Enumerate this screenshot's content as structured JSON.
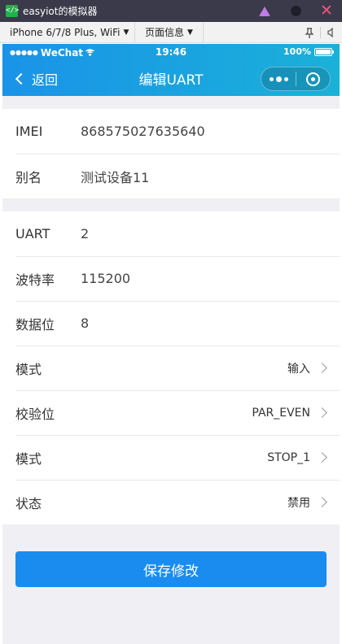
{
  "window": {
    "app_icon": "</>",
    "title": "easyiot的模拟器"
  },
  "toolbar": {
    "device": "iPhone 6/7/8 Plus, WiFi",
    "page_info": "页面信息",
    "pin_icon": "pin-icon",
    "mute_icon": "speaker-icon"
  },
  "statusbar": {
    "signal": "●●●●●",
    "carrier": "WeChat",
    "wifi": "wifi-icon",
    "time": "19:46",
    "battery": "100%"
  },
  "navbar": {
    "back_label": "返回",
    "title": "编辑UART"
  },
  "device_section": [
    {
      "label": "IMEI",
      "value": "868575027635640"
    },
    {
      "label": "别名",
      "value": "测试设备11"
    }
  ],
  "uart_section": {
    "static_rows": [
      {
        "label": "UART",
        "value": "2"
      },
      {
        "label": "波特率",
        "value": "115200"
      },
      {
        "label": "数据位",
        "value": "8"
      }
    ],
    "picker_rows": [
      {
        "label": "模式",
        "value": "输入"
      },
      {
        "label": "校验位",
        "value": "PAR_EVEN"
      },
      {
        "label": "模式",
        "value": "STOP_1"
      },
      {
        "label": "状态",
        "value": "禁用"
      }
    ]
  },
  "actions": {
    "save_label": "保存修改"
  },
  "colors": {
    "titlebar": "#3a3a4a",
    "header_gradient_start": "#1a93e8",
    "header_gradient_end": "#1ab1d8",
    "primary_button": "#1a8cf0",
    "page_background": "#efeff4"
  }
}
